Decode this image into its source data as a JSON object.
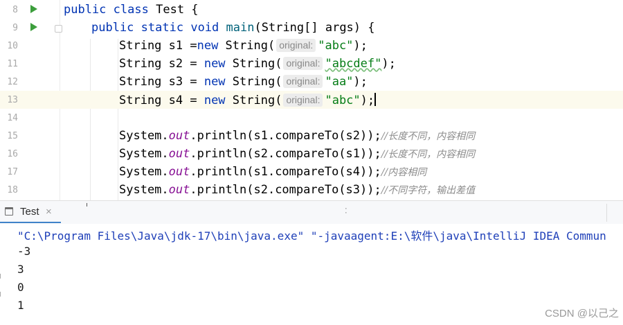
{
  "editor": {
    "lines": [
      {
        "num": "8"
      },
      {
        "num": "9"
      },
      {
        "num": "10"
      },
      {
        "num": "11"
      },
      {
        "num": "12"
      },
      {
        "num": "13"
      },
      {
        "num": "14"
      },
      {
        "num": "15"
      },
      {
        "num": "16"
      },
      {
        "num": "17"
      },
      {
        "num": "18"
      }
    ],
    "kw_public": "public",
    "kw_class": "class",
    "class_name": "Test {",
    "kw_static": "static",
    "kw_void": "void",
    "method_name": "main",
    "method_params": "(String[] args) {",
    "decl_s1": "String s1 =",
    "decl_s2": "String s2 = ",
    "decl_s3": "String s3 = ",
    "decl_s4": "String s4 = ",
    "kw_new": "new",
    "ctor_string": " String(",
    "hint_original": "original:",
    "str_abc": "\"abc\"",
    "str_abcdef": "\"abcdef\"",
    "str_aa": "\"aa\"",
    "close_semicolon": ");",
    "sys_prefix": "System.",
    "sys_out": "out",
    "call_15": ".println(s1.compareTo(s2));",
    "call_16": ".println(s2.compareTo(s1));",
    "call_17": ".println(s1.compareTo(s4));",
    "call_18": ".println(s2.compareTo(s3));",
    "comment_15": "//长度不同，内容相同",
    "comment_16": "//长度不同，内容相同",
    "comment_17": "//内容相同",
    "comment_18": "//不同字符，输出差值"
  },
  "run_panel": {
    "tab_label": "Test",
    "tab_close": "×",
    "command": "\"C:\\Program Files\\Java\\jdk-17\\bin\\java.exe\" \"-javaagent:E:\\软件\\java\\IntelliJ IDEA Commun",
    "outputs": [
      "-3",
      "3",
      "0",
      "1"
    ]
  },
  "watermark": "CSDN @以己之",
  "colors": {
    "keyword": "#0033b3",
    "string": "#067d17",
    "static_field": "#871094",
    "comment": "#8c8c8c",
    "run_icon": "#3c9e3c"
  },
  "icons": [
    "run-gutter-icon",
    "fold-marker-icon",
    "console-icon",
    "close-icon"
  ]
}
